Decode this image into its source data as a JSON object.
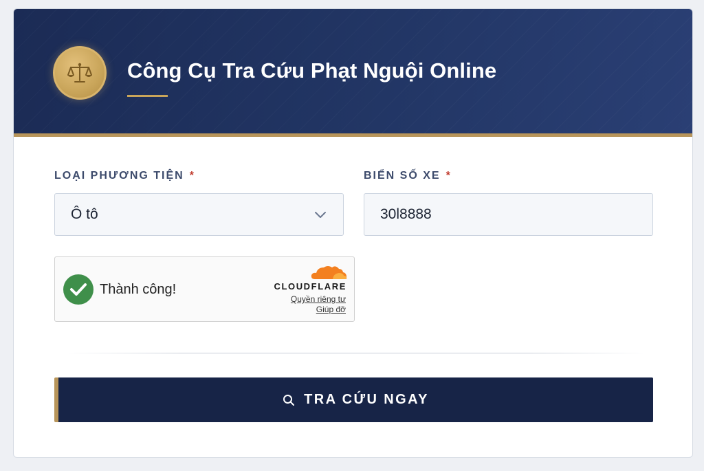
{
  "header": {
    "title": "Công Cụ Tra Cứu Phạt Nguội Online",
    "logo_icon": "scales-of-justice-icon"
  },
  "form": {
    "vehicle_type": {
      "label": "LOẠI PHƯƠNG TIỆN",
      "required_mark": "*",
      "selected": "Ô tô",
      "icon": "chevron-down-icon"
    },
    "plate": {
      "label": "BIỂN SỐ XE",
      "required_mark": "*",
      "value": "30l8888"
    }
  },
  "captcha": {
    "status_text": "Thành công!",
    "status_icon": "checkmark-icon",
    "provider": "CLOUDFLARE",
    "privacy_link": "Quyền riêng tư",
    "help_link": "Giúp đỡ"
  },
  "submit": {
    "label": "TRA CỨU NGAY",
    "icon": "search-icon"
  },
  "colors": {
    "header_bg": "#1f3160",
    "accent_gold": "#b8955a",
    "button_bg": "#172447",
    "success_green": "#3f8f4a",
    "cloudflare_orange": "#f38020",
    "required_red": "#c0392b"
  }
}
